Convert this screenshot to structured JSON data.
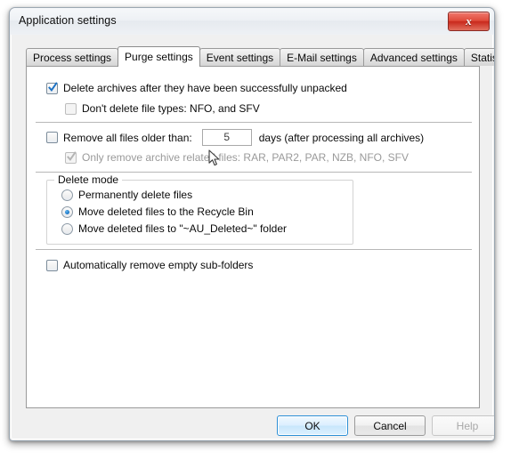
{
  "window": {
    "title": "Application settings",
    "close_label": "x"
  },
  "tabs": [
    {
      "label": "Process settings",
      "active": false
    },
    {
      "label": "Purge settings",
      "active": true
    },
    {
      "label": "Event settings",
      "active": false
    },
    {
      "label": "E-Mail settings",
      "active": false
    },
    {
      "label": "Advanced settings",
      "active": false
    },
    {
      "label": "Statistics",
      "active": false
    }
  ],
  "purge": {
    "delete_archives": {
      "label": "Delete archives after they have been successfully unpacked",
      "checked": true,
      "enabled": true
    },
    "dont_delete_types": {
      "label": "Don't delete file types: NFO, and SFV",
      "checked": false,
      "enabled": false
    },
    "remove_older": {
      "label": "Remove all files older than:",
      "checked": false,
      "enabled": true
    },
    "days_value": "5",
    "days_suffix": "days (after processing all archives)",
    "only_archive_related": {
      "label": "Only remove archive related files: RAR, PAR2, PAR, NZB, NFO, SFV",
      "checked": true,
      "enabled": false
    },
    "delete_mode": {
      "title": "Delete mode",
      "options": [
        {
          "label": "Permanently delete files",
          "selected": false
        },
        {
          "label": "Move deleted files to the Recycle Bin",
          "selected": true
        },
        {
          "label": "Move deleted files to \"~AU_Deleted~\" folder",
          "selected": false
        }
      ]
    },
    "auto_remove_empty": {
      "label": "Automatically remove empty sub-folders",
      "checked": false,
      "enabled": true
    }
  },
  "buttons": {
    "ok": "OK",
    "cancel": "Cancel",
    "help": "Help"
  },
  "colors": {
    "accent": "#1a74c4",
    "close_red": "#c9291c",
    "default_button_border": "#2c8fd6"
  }
}
